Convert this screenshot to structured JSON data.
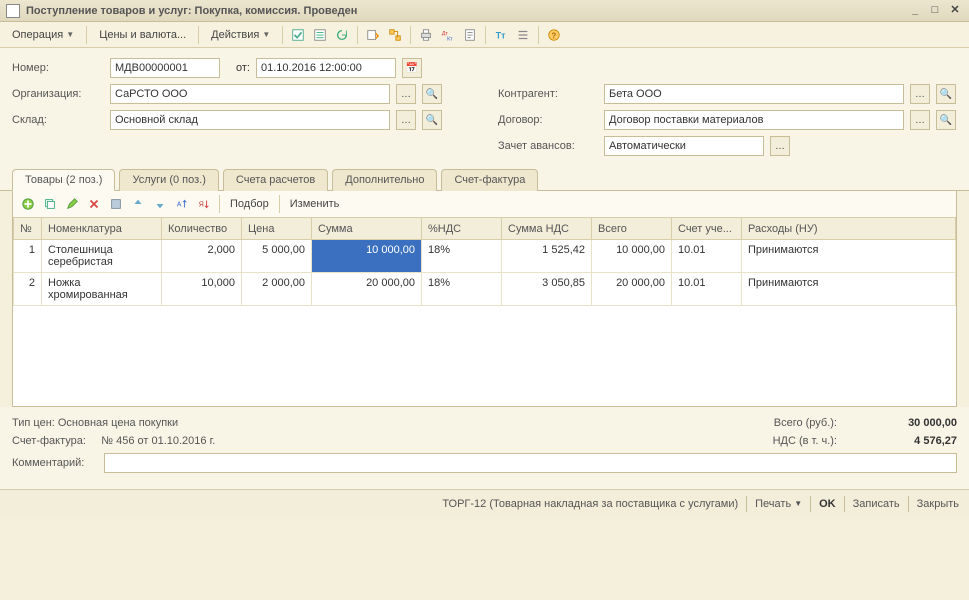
{
  "title": "Поступление товаров и услуг: Покупка, комиссия. Проведен",
  "menu": {
    "operation": "Операция",
    "prices": "Цены и валюта...",
    "actions": "Действия"
  },
  "form": {
    "number_label": "Номер:",
    "number": "МДВ00000001",
    "from_label": "от:",
    "date": "01.10.2016 12:00:00",
    "org_label": "Организация:",
    "org": "СаРСТО ООО",
    "warehouse_label": "Склад:",
    "warehouse": "Основной склад",
    "contragent_label": "Контрагент:",
    "contragent": "Бета ООО",
    "contract_label": "Договор:",
    "contract": "Договор поставки материалов",
    "advance_label": "Зачет авансов:",
    "advance": "Автоматически"
  },
  "tabs": {
    "goods": "Товары (2 поз.)",
    "services": "Услуги (0 поз.)",
    "accounts": "Счета расчетов",
    "extra": "Дополнительно",
    "invoice": "Счет-фактура"
  },
  "tab_toolbar": {
    "selection": "Подбор",
    "edit": "Изменить"
  },
  "grid": {
    "headers": {
      "n": "№",
      "nomen": "Номенклатура",
      "qty": "Количество",
      "price": "Цена",
      "sum": "Сумма",
      "vat_rate": "%НДС",
      "vat_sum": "Сумма НДС",
      "total": "Всего",
      "account": "Счет уче...",
      "expenses": "Расходы (НУ)"
    },
    "rows": [
      {
        "n": "1",
        "nomen": "Столешница серебристая",
        "qty": "2,000",
        "price": "5 000,00",
        "sum": "10 000,00",
        "vat_rate": "18%",
        "vat_sum": "1 525,42",
        "total": "10 000,00",
        "account": "10.01",
        "expenses": "Принимаются"
      },
      {
        "n": "2",
        "nomen": "Ножка хромированная",
        "qty": "10,000",
        "price": "2 000,00",
        "sum": "20 000,00",
        "vat_rate": "18%",
        "vat_sum": "3 050,85",
        "total": "20 000,00",
        "account": "10.01",
        "expenses": "Принимаются"
      }
    ]
  },
  "footer": {
    "price_type": "Тип цен: Основная цена покупки",
    "invoice_label": "Счет-фактура:",
    "invoice_text": "№ 456 от 01.10.2016 г.",
    "comment_label": "Комментарий:",
    "comment": "",
    "total_label": "Всего (руб.):",
    "total": "30 000,00",
    "vat_label": "НДС (в т. ч.):",
    "vat": "4 576,27"
  },
  "bottom": {
    "torg": "ТОРГ-12 (Товарная накладная за поставщика с услугами)",
    "print": "Печать",
    "ok": "OK",
    "save": "Записать",
    "close": "Закрыть"
  }
}
